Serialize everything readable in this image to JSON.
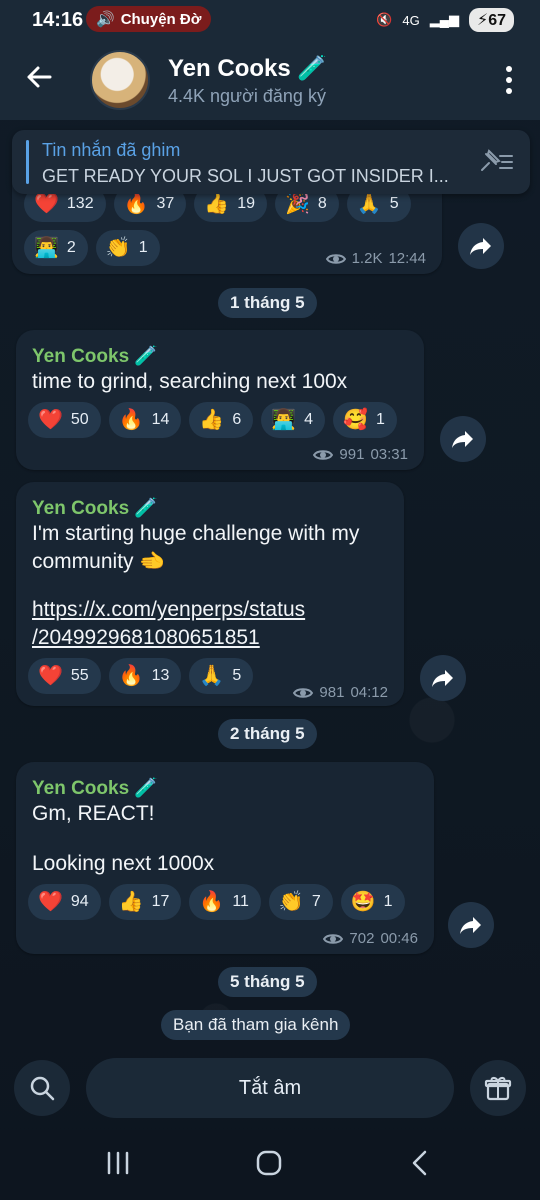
{
  "status": {
    "time": "14:16",
    "call_pill": "Chuyện Đờ",
    "network": "4G",
    "battery": "67"
  },
  "header": {
    "title": "Yen Cooks 🧪",
    "subscribers": "4.4K người đăng ký"
  },
  "pinned": {
    "title": "Tin nhắn đã ghim",
    "text": "GET READY YOUR SOL  I JUST GOT INSIDER I..."
  },
  "messages": [
    {
      "reactions": [
        {
          "emoji": "❤️",
          "count": "132"
        },
        {
          "emoji": "🔥",
          "count": "37"
        },
        {
          "emoji": "👍",
          "count": "19"
        },
        {
          "emoji": "🎉",
          "count": "8"
        },
        {
          "emoji": "🙏",
          "count": "5"
        },
        {
          "emoji": "👨‍💻",
          "count": "2"
        },
        {
          "emoji": "👏",
          "count": "1"
        }
      ],
      "views": "1.2K",
      "time": "12:44"
    },
    {
      "sender": "Yen Cooks 🧪",
      "text": "time to grind, searching next 100x",
      "reactions": [
        {
          "emoji": "❤️",
          "count": "50"
        },
        {
          "emoji": "🔥",
          "count": "14"
        },
        {
          "emoji": "👍",
          "count": "6"
        },
        {
          "emoji": "👨‍💻",
          "count": "4"
        },
        {
          "emoji": "🥰",
          "count": "1"
        }
      ],
      "views": "991",
      "time": "03:31"
    },
    {
      "sender": "Yen Cooks 🧪",
      "text_line1": "I'm starting huge challenge with my",
      "text_line2": "community 🫲",
      "link_line1": "https://x.com/yenperps/status",
      "link_line2": "/2049929681080651851",
      "reactions": [
        {
          "emoji": "❤️",
          "count": "55"
        },
        {
          "emoji": "🔥",
          "count": "13"
        },
        {
          "emoji": "🙏",
          "count": "5"
        }
      ],
      "views": "981",
      "time": "04:12"
    },
    {
      "sender": "Yen Cooks 🧪",
      "text_line1": "Gm, REACT!",
      "text_line2": "Looking next 1000x",
      "reactions": [
        {
          "emoji": "❤️",
          "count": "94"
        },
        {
          "emoji": "👍",
          "count": "17"
        },
        {
          "emoji": "🔥",
          "count": "11"
        },
        {
          "emoji": "👏",
          "count": "7"
        },
        {
          "emoji": "🤩",
          "count": "1"
        }
      ],
      "views": "702",
      "time": "00:46"
    }
  ],
  "dates": [
    "1 tháng 5",
    "2 tháng 5",
    "5 tháng 5"
  ],
  "joined_notice": "Bạn đã tham gia kênh",
  "bottom": {
    "mute_label": "Tắt âm"
  },
  "colors": {
    "accent": "#5aa2e6",
    "sender": "#7ec66b",
    "bubble": "#182533",
    "reaction": "#24384c"
  }
}
